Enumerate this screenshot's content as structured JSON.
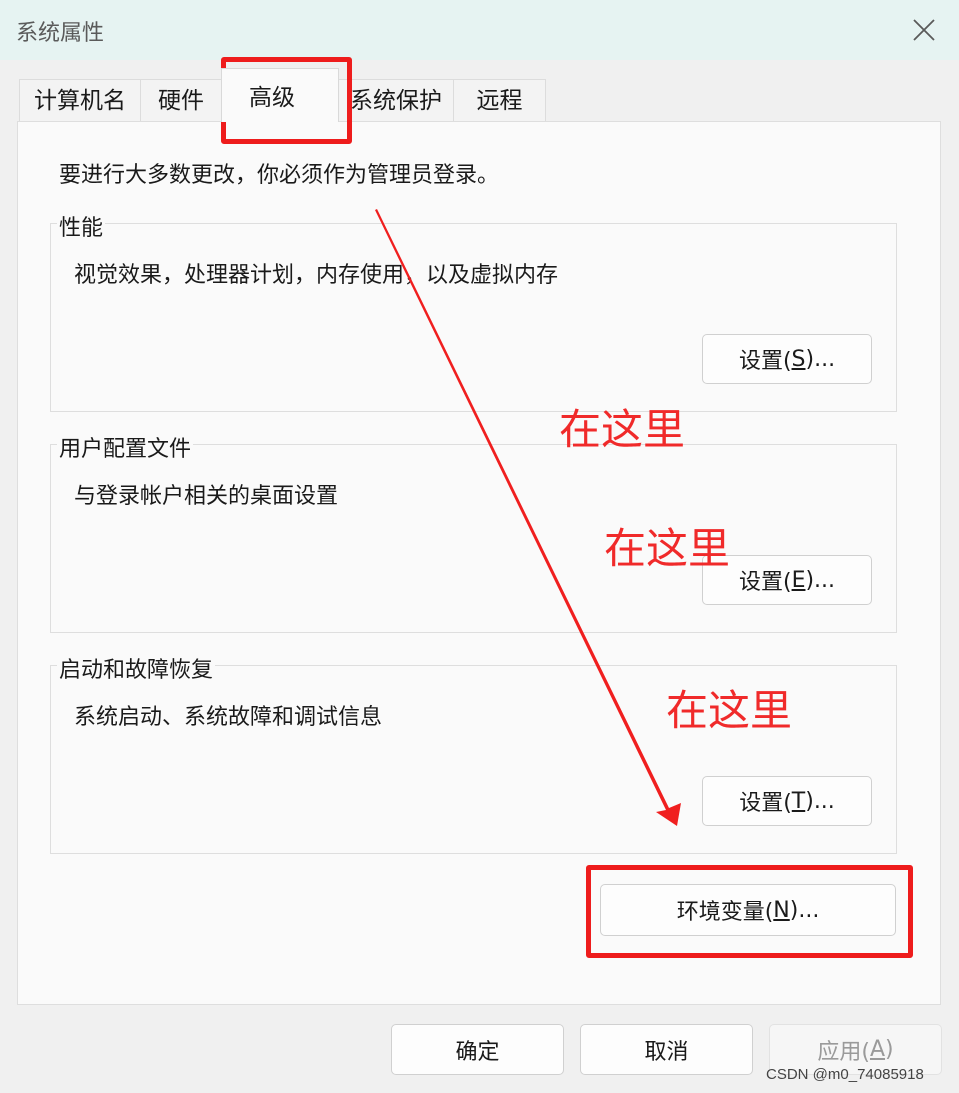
{
  "window": {
    "title": "系统属性"
  },
  "tabs": [
    {
      "label": "计算机名"
    },
    {
      "label": "硬件"
    },
    {
      "label": "高级"
    },
    {
      "label": "系统保护"
    },
    {
      "label": "远程"
    }
  ],
  "intro": "要进行大多数更改，你必须作为管理员登录。",
  "groups": {
    "performance": {
      "title": "性能",
      "desc": "视觉效果，处理器计划，内存使用，以及虚拟内存",
      "button": {
        "text": "设置(",
        "key": "S",
        "suffix": ")..."
      }
    },
    "profile": {
      "title": "用户配置文件",
      "desc": "与登录帐户相关的桌面设置",
      "button": {
        "text": "设置(",
        "key": "E",
        "suffix": ")..."
      }
    },
    "startup": {
      "title": "启动和故障恢复",
      "desc": "系统启动、系统故障和调试信息",
      "button": {
        "text": "设置(",
        "key": "T",
        "suffix": ")..."
      }
    }
  },
  "env_button": {
    "text": "环境变量(",
    "key": "N",
    "suffix": ")..."
  },
  "footer": {
    "ok": "确定",
    "cancel": "取消",
    "apply": {
      "text": "应用(",
      "key": "A",
      "suffix": ")"
    }
  },
  "annotations": [
    "在这里",
    "在这里",
    "在这里"
  ],
  "watermark": "CSDN @m0_74085918",
  "colors": {
    "annotation_red": "#ee1c1c",
    "titlebar": "#e6f3f2"
  }
}
